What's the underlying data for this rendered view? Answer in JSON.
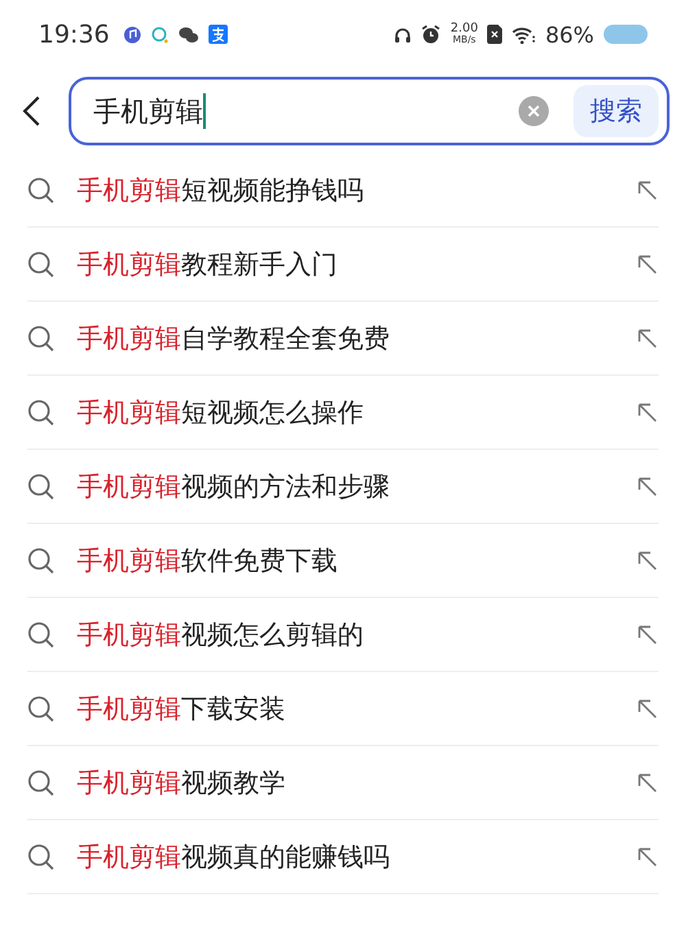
{
  "status_bar": {
    "time": "19:36",
    "speed_value": "2.00",
    "speed_unit": "MB/s",
    "battery": "86%"
  },
  "search": {
    "value": "手机剪辑",
    "button": "搜索"
  },
  "suggestions": [
    {
      "match": "手机剪辑",
      "rest": "短视频能挣钱吗"
    },
    {
      "match": "手机剪辑",
      "rest": "教程新手入门"
    },
    {
      "match": "手机剪辑",
      "rest": "自学教程全套免费"
    },
    {
      "match": "手机剪辑",
      "rest": "短视频怎么操作"
    },
    {
      "match": "手机剪辑",
      "rest": "视频的方法和步骤"
    },
    {
      "match": "手机剪辑",
      "rest": "软件免费下载"
    },
    {
      "match": "手机剪辑",
      "rest": "视频怎么剪辑的"
    },
    {
      "match": "手机剪辑",
      "rest": "下载安装"
    },
    {
      "match": "手机剪辑",
      "rest": "视频教学"
    },
    {
      "match": "手机剪辑",
      "rest": "视频真的能赚钱吗"
    }
  ]
}
